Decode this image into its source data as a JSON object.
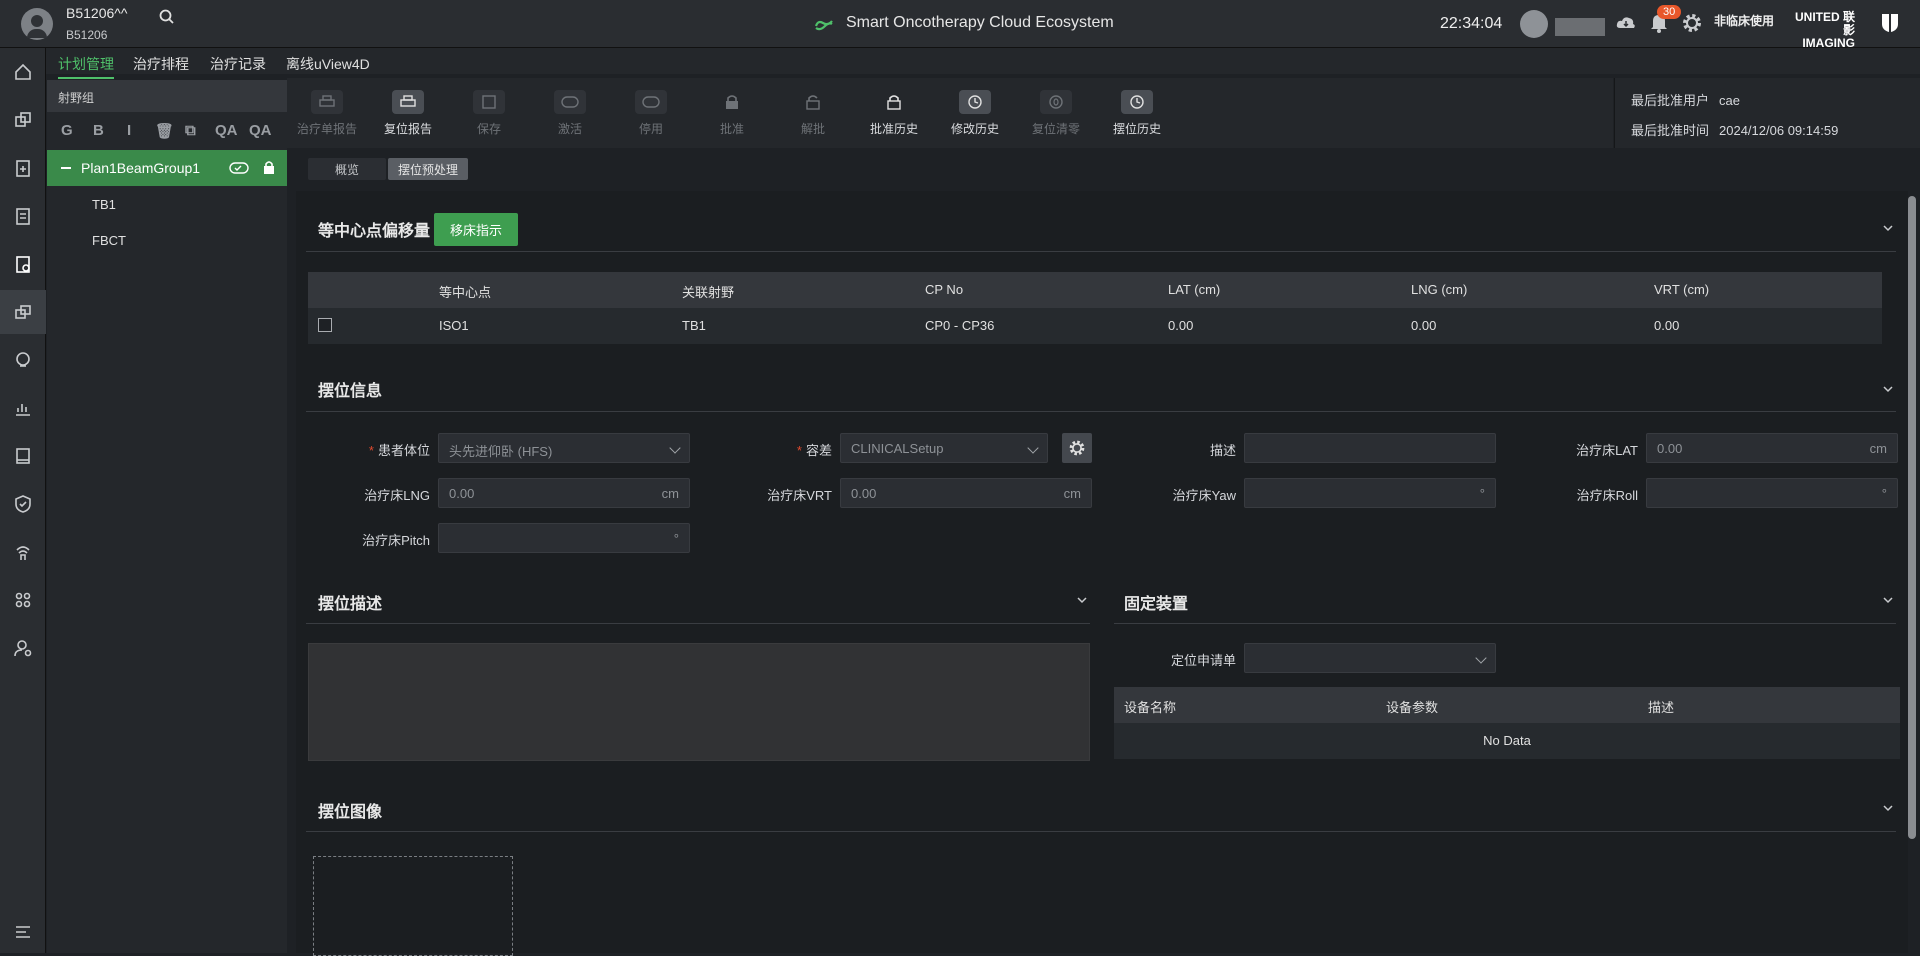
{
  "header": {
    "patient_name": "B51206^^",
    "patient_id": "B51206",
    "app_title": "Smart Oncotherapy Cloud Ecosystem",
    "clock": "22:34:04",
    "notification_count": "30",
    "non_clinical": "非临床使用",
    "brand_line1": "UNITED 联影",
    "brand_line2": "IMAGING"
  },
  "tabs": [
    "计划管理",
    "治疗排程",
    "治疗记录",
    "离线uView4D"
  ],
  "left_panel": {
    "header": "射野组",
    "tools": [
      "G",
      "B",
      "I",
      "🗑",
      "⧉",
      "QA",
      "QA"
    ],
    "tree_selected": "Plan1BeamGroup1",
    "tree_items": [
      "TB1",
      "FBCT"
    ]
  },
  "toolbar": [
    {
      "label": "治疗单报告",
      "enabled": false
    },
    {
      "label": "复位报告",
      "enabled": true
    },
    {
      "label": "保存",
      "enabled": false
    },
    {
      "label": "激活",
      "enabled": false
    },
    {
      "label": "停用",
      "enabled": false
    },
    {
      "label": "批准",
      "enabled": false
    },
    {
      "label": "解批",
      "enabled": false
    },
    {
      "label": "批准历史",
      "enabled": true
    },
    {
      "label": "修改历史",
      "enabled": true
    },
    {
      "label": "复位清零",
      "enabled": false
    },
    {
      "label": "摆位历史",
      "enabled": true
    }
  ],
  "approval": {
    "last_user_label": "最后批准用户",
    "last_user": "cae",
    "last_time_label": "最后批准时间",
    "last_time": "2024/12/06 09:14:59"
  },
  "subtabs": [
    "概览",
    "摆位预处理"
  ],
  "iso_section": {
    "title": "等中心点偏移量",
    "button": "移床指示",
    "headers": [
      "等中心点",
      "关联射野",
      "CP No",
      "LAT (cm)",
      "LNG (cm)",
      "VRT (cm)"
    ],
    "rows": [
      [
        "ISO1",
        "TB1",
        "CP0 - CP36",
        "0.00",
        "0.00",
        "0.00"
      ]
    ]
  },
  "setup_section": {
    "title": "摆位信息",
    "patient_position_label": "患者体位",
    "patient_position_value": "头先进仰卧 (HFS)",
    "tolerance_label": "容差",
    "tolerance_value": "CLINICALSetup",
    "desc_label": "描述",
    "lat_label": "治疗床LAT",
    "lat_value": "0.00",
    "lng_label": "治疗床LNG",
    "lng_value": "0.00",
    "vrt_label": "治疗床VRT",
    "vrt_value": "0.00",
    "yaw_label": "治疗床Yaw",
    "roll_label": "治疗床Roll",
    "pitch_label": "治疗床Pitch",
    "unit_cm": "cm",
    "unit_deg": "°"
  },
  "desc_section": {
    "title": "摆位描述"
  },
  "fixation_section": {
    "title": "固定装置",
    "request_label": "定位申请单",
    "headers": [
      "设备名称",
      "设备参数",
      "描述"
    ],
    "empty": "No Data"
  },
  "image_section": {
    "title": "摆位图像"
  }
}
